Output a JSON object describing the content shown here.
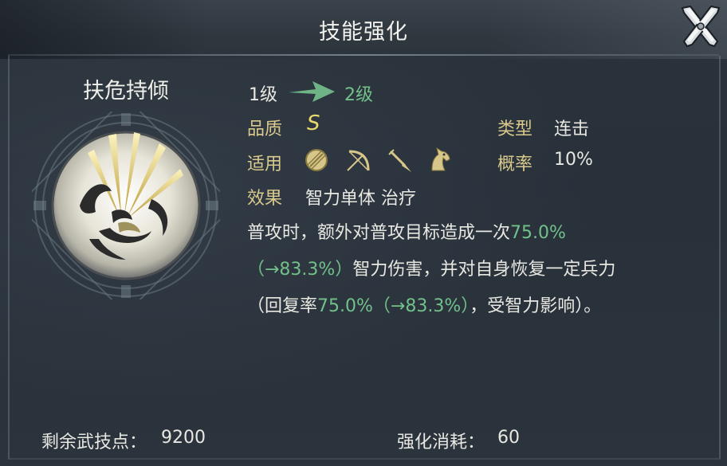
{
  "window": {
    "title": "技能强化",
    "close_icon": "crossed-swords-close-icon"
  },
  "skill": {
    "name": "扶危持倾",
    "emblem_icon": "light-burst-skill-emblem",
    "level_from": "1级",
    "level_to": "2级",
    "quality_label": "品质",
    "quality_value": "S",
    "type_label": "类型",
    "type_value": "连击",
    "apply_label": "适用",
    "apply_icons": [
      "shield-icon",
      "bow-icon",
      "spear-icon",
      "horse-icon"
    ],
    "rate_label": "概率",
    "rate_value": "10%",
    "effect_label": "效果",
    "effect_value": "智力单体 治疗"
  },
  "description": {
    "part1": "普攻时，额外对普攻目标造成一次",
    "value1": "75.0%",
    "value1_next": "（→83.3%）",
    "part2": "智力伤害，并对自身恢复一定兵力",
    "part3": "（回复率",
    "value2": "75.0%（→83.3%）",
    "part4": "，受智力影响）。"
  },
  "footer": {
    "points_label": "剩余武技点：",
    "points_value": "9200",
    "cost_label": "强化消耗：",
    "cost_value": "60"
  },
  "colors": {
    "accent_green": "#72c08a",
    "label_gold": "#d9c98d",
    "grade_yellow": "#e9d96a"
  }
}
